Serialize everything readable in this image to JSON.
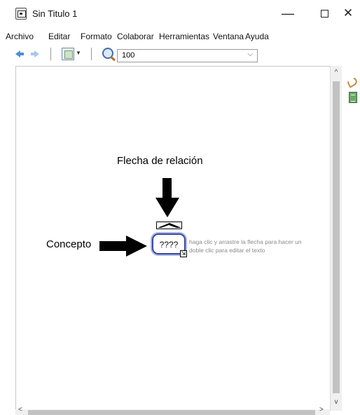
{
  "window": {
    "title": "Sin Titulo 1",
    "minimize_glyph": "—",
    "close_glyph": "✕"
  },
  "menu": {
    "items": [
      "Archivo",
      "Editar",
      "Formato",
      "Colaborar",
      "Herramientas",
      "Ventana",
      "Ayuda"
    ]
  },
  "toolbar": {
    "zoom_value": "100",
    "icons": [
      "back-arrow-icon",
      "forward-arrow-icon",
      "view-icon",
      "zoom-icon"
    ]
  },
  "canvas": {
    "relation_label": "Flecha de relación",
    "concept_label": "Concepto",
    "concept_text": "????",
    "hint_line1": "haga clic y arrastre la flecha para hacer un",
    "hint_line2": "doble clic para editar el texto"
  },
  "colors": {
    "concept_border": "#3a4a9c",
    "concept_glow": "#a9b6e8",
    "hint_text": "#8a8a8a"
  }
}
